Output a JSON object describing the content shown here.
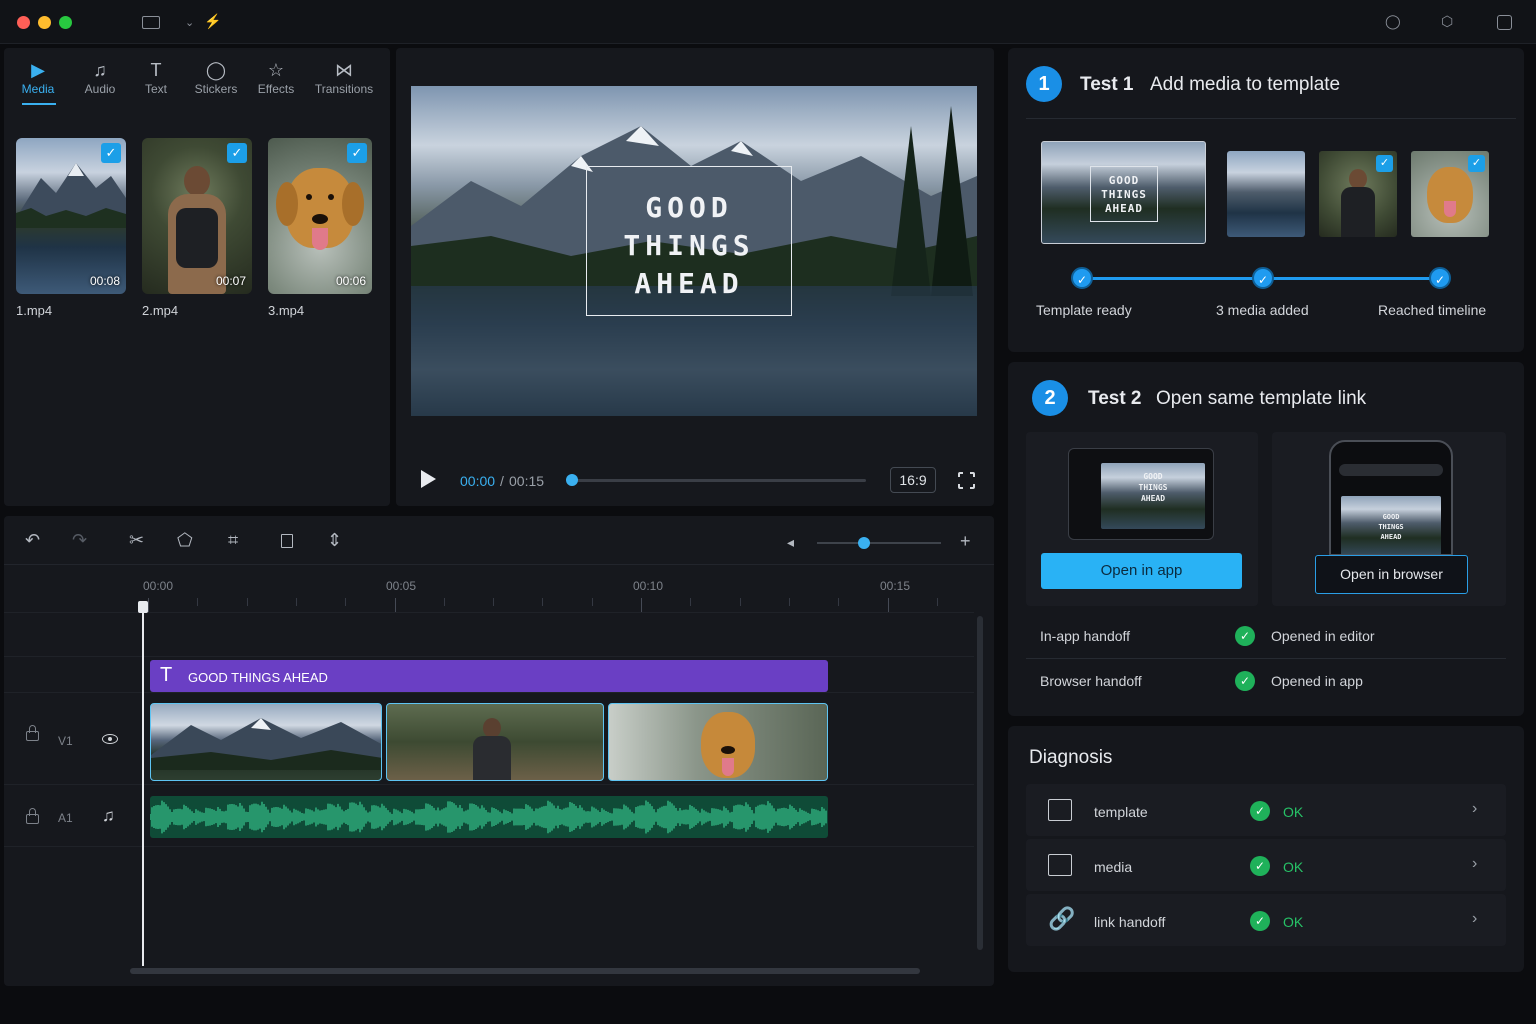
{
  "titlebar": {
    "icons": [
      "layout-icon",
      "chevron-down-icon",
      "magic-icon",
      "notification-icon",
      "share-icon",
      "export-icon"
    ]
  },
  "media_panel": {
    "tabs": [
      {
        "label": "Media",
        "icon": "media-icon",
        "glyph": "▶",
        "active": true
      },
      {
        "label": "Audio",
        "icon": "music-note-icon",
        "glyph": "♫",
        "active": false
      },
      {
        "label": "Text",
        "icon": "text-icon",
        "glyph": "T",
        "active": false
      },
      {
        "label": "Stickers",
        "icon": "sticker-icon",
        "glyph": "◯",
        "active": false
      },
      {
        "label": "Effects",
        "icon": "sparkle-icon",
        "glyph": "☆",
        "active": false
      },
      {
        "label": "Transitions",
        "icon": "transition-icon",
        "glyph": "⋈",
        "active": false
      }
    ],
    "items": [
      {
        "name": "1.mp4",
        "duration": "00:08",
        "subject": "mountain lake"
      },
      {
        "name": "2.mp4",
        "duration": "00:07",
        "subject": "hiker with backpack"
      },
      {
        "name": "3.mp4",
        "duration": "00:06",
        "subject": "golden retriever dog"
      }
    ]
  },
  "preview": {
    "overlay_lines": [
      "GOOD",
      "THINGS",
      "AHEAD"
    ],
    "current_time": "00:00",
    "separator": "/",
    "total_time": "00:15",
    "progress": 0.0,
    "aspect_ratio": "16:9"
  },
  "timeline": {
    "toolbar": [
      "undo-icon",
      "redo-icon",
      "split-icon",
      "crop-icon",
      "trim-icon",
      "delete-icon",
      "freeze-icon"
    ],
    "zoom_level": 0.38,
    "ruler": [
      "00:00",
      "00:05",
      "00:10",
      "00:15"
    ],
    "text_clip": "GOOD THINGS AHEAD",
    "video_track": "V1",
    "audio_track": "A1"
  },
  "test1": {
    "number": "1",
    "title": "Test 1",
    "subtitle": "Add media to template",
    "template_lines": [
      "GOOD",
      "THINGS",
      "AHEAD"
    ],
    "steps": [
      "Template ready",
      "3 media added",
      "Reached timeline"
    ]
  },
  "test2": {
    "number": "2",
    "title": "Test 2",
    "subtitle": "Open same template link",
    "app_button": "Open in app",
    "browser_button": "Open in browser",
    "mock_lines": [
      "GOOD",
      "THINGS",
      "AHEAD"
    ],
    "rows": [
      {
        "label": "In-app handoff",
        "status": "Opened in editor"
      },
      {
        "label": "Browser handoff",
        "status": "Opened in app"
      }
    ]
  },
  "diagnosis": {
    "title": "Diagnosis",
    "rows": [
      {
        "label": "template",
        "status": "OK",
        "icon": "image-frame-icon"
      },
      {
        "label": "media",
        "status": "OK",
        "icon": "image-icon"
      },
      {
        "label": "link handoff",
        "status": "OK",
        "icon": "link-icon"
      }
    ]
  },
  "colors": {
    "accent": "#1a8fe6",
    "success": "#1fb15a",
    "text_clip": "#6a3fc4",
    "audio_clip": "#0f4b37"
  }
}
